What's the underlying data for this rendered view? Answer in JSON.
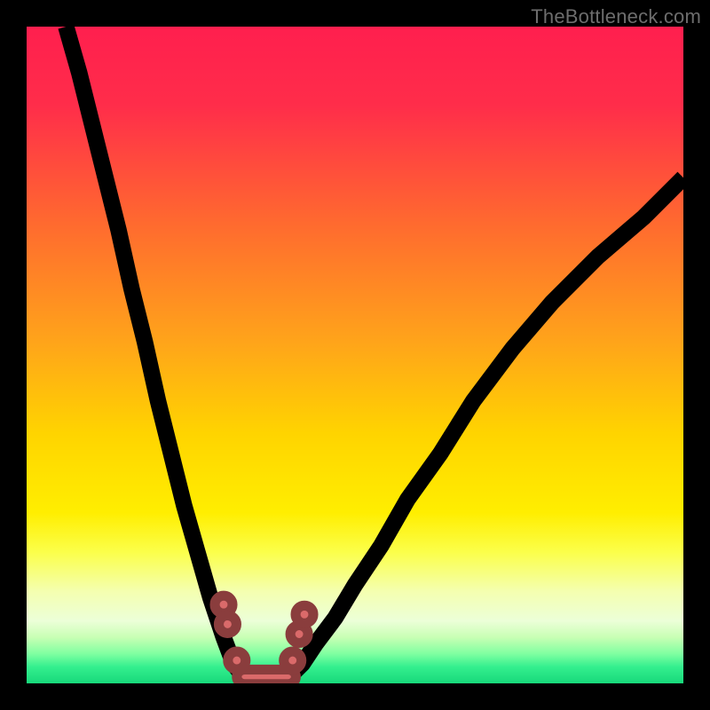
{
  "watermark": "TheBottleneck.com",
  "gradient_stops": [
    {
      "offset": 0.0,
      "color": "#ff1f4e"
    },
    {
      "offset": 0.12,
      "color": "#ff2d4a"
    },
    {
      "offset": 0.3,
      "color": "#ff6a2f"
    },
    {
      "offset": 0.48,
      "color": "#ffa41a"
    },
    {
      "offset": 0.62,
      "color": "#ffd400"
    },
    {
      "offset": 0.74,
      "color": "#ffee00"
    },
    {
      "offset": 0.8,
      "color": "#fbff4a"
    },
    {
      "offset": 0.86,
      "color": "#f4ffb0"
    },
    {
      "offset": 0.905,
      "color": "#ecffd8"
    },
    {
      "offset": 0.93,
      "color": "#c8ffb4"
    },
    {
      "offset": 0.955,
      "color": "#7fffa1"
    },
    {
      "offset": 0.975,
      "color": "#34ef8e"
    },
    {
      "offset": 1.0,
      "color": "#17d87a"
    }
  ],
  "chart_data": {
    "type": "line",
    "title": "",
    "xlabel": "",
    "ylabel": "",
    "xlim": [
      0,
      100
    ],
    "ylim": [
      0,
      100
    ],
    "grid": false,
    "series": [
      {
        "name": "left-curve",
        "x": [
          6,
          8,
          10,
          12,
          14,
          16,
          18,
          20,
          22,
          24,
          26,
          28,
          30,
          31.5,
          33
        ],
        "y": [
          100,
          93,
          85,
          77,
          69,
          60,
          52,
          43,
          35,
          27,
          20,
          13,
          7,
          3,
          1
        ]
      },
      {
        "name": "right-curve",
        "x": [
          40,
          42,
          44,
          47,
          50,
          54,
          58,
          63,
          68,
          74,
          80,
          87,
          94,
          100
        ],
        "y": [
          1,
          3,
          6,
          10,
          15,
          21,
          28,
          35,
          43,
          51,
          58,
          65,
          71,
          77
        ]
      },
      {
        "name": "trough",
        "x": [
          33,
          40
        ],
        "y": [
          1,
          1
        ]
      }
    ],
    "markers": [
      {
        "name": "left-dot-1",
        "x": 30.0,
        "y": 12.0
      },
      {
        "name": "left-dot-2",
        "x": 30.6,
        "y": 9.0
      },
      {
        "name": "left-dot-3",
        "x": 32.0,
        "y": 3.5
      },
      {
        "name": "right-dot-1",
        "x": 40.5,
        "y": 3.5
      },
      {
        "name": "right-dot-2",
        "x": 41.5,
        "y": 7.5
      },
      {
        "name": "right-dot-3",
        "x": 42.3,
        "y": 10.5
      }
    ],
    "trough_bar": {
      "x0": 32.0,
      "x1": 41.0,
      "y": 1.0
    }
  }
}
